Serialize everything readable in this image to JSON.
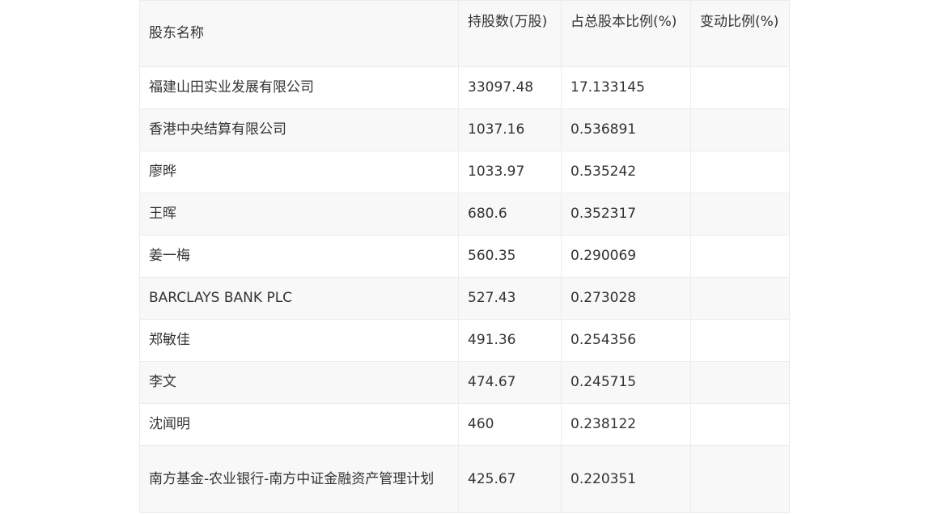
{
  "headers": {
    "name": "股东名称",
    "shares": "持股数(万股)",
    "ratio": "占总股本比例(%)",
    "change": "变动比例(%)"
  },
  "rows": [
    {
      "name": "福建山田实业发展有限公司",
      "shares": "33097.48",
      "ratio": "17.133145",
      "change": ""
    },
    {
      "name": "香港中央结算有限公司",
      "shares": "1037.16",
      "ratio": "0.536891",
      "change": ""
    },
    {
      "name": "廖晔",
      "shares": "1033.97",
      "ratio": "0.535242",
      "change": ""
    },
    {
      "name": "王晖",
      "shares": "680.6",
      "ratio": "0.352317",
      "change": ""
    },
    {
      "name": "姜一梅",
      "shares": "560.35",
      "ratio": "0.290069",
      "change": ""
    },
    {
      "name": "BARCLAYS BANK PLC",
      "shares": "527.43",
      "ratio": "0.273028",
      "change": ""
    },
    {
      "name": "郑敏佳",
      "shares": "491.36",
      "ratio": "0.254356",
      "change": ""
    },
    {
      "name": "李文",
      "shares": "474.67",
      "ratio": "0.245715",
      "change": ""
    },
    {
      "name": "沈闻明",
      "shares": "460",
      "ratio": "0.238122",
      "change": ""
    },
    {
      "name": "南方基金-农业银行-南方中证金融资产管理计划",
      "shares": "425.67",
      "ratio": "0.220351",
      "change": ""
    }
  ]
}
